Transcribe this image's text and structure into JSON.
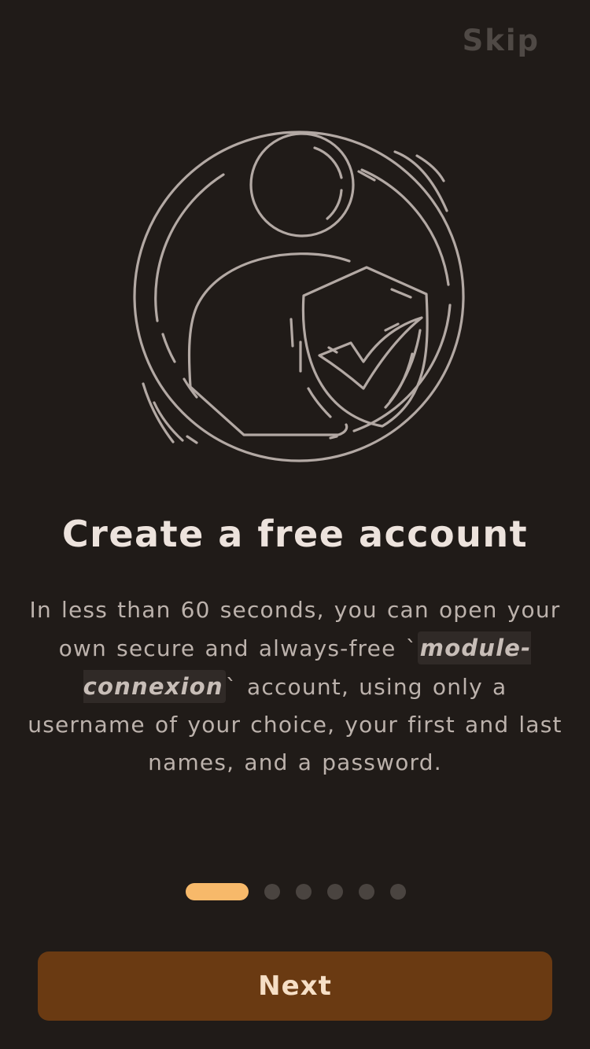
{
  "header": {
    "skip_label": "Skip"
  },
  "illustration": {
    "icon": "user-shield-check-icon"
  },
  "content": {
    "title": "Create a free account",
    "description_before": "In less than 60 seconds, you can open your own secure and always-free `",
    "description_code": "module-connexion",
    "description_after": "` account, using only a username of your choice, your first and last names, and a password."
  },
  "pagination": {
    "total": 6,
    "active_index": 0
  },
  "footer": {
    "next_label": "Next"
  },
  "colors": {
    "background": "#201b18",
    "accent": "#f7b96a",
    "button": "#6a3a12",
    "title": "#ede3dd",
    "body_text": "#bcb2ac",
    "muted": "#4f4945",
    "illustration_stroke": "#b3a9a4"
  }
}
